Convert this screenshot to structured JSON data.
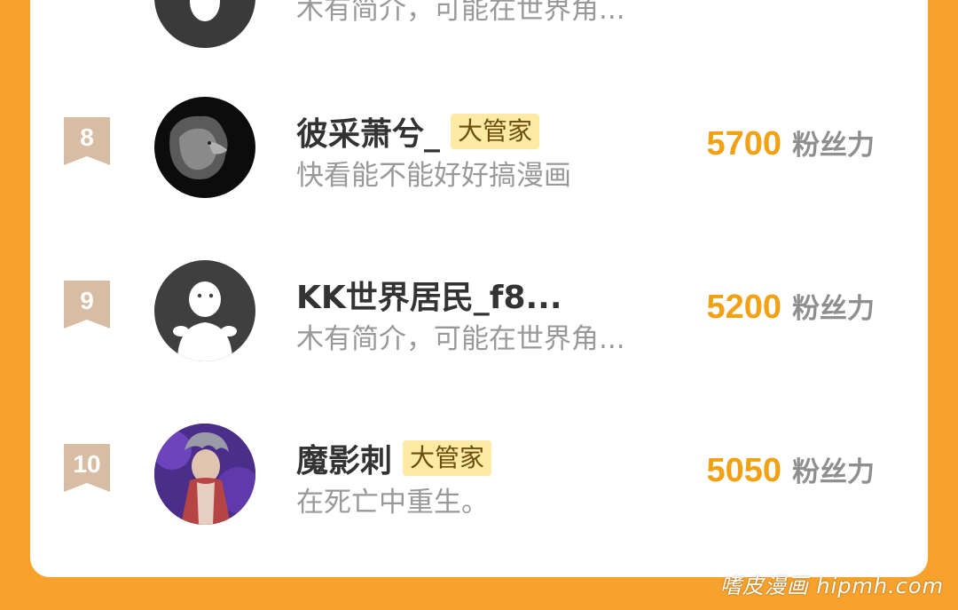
{
  "partial_row": {
    "bio": "木有简介，可能在世界角..."
  },
  "rows": [
    {
      "rank": "8",
      "name": "彼采萧兮_",
      "tag": "大管家",
      "bio": "快看能不能好好搞漫画",
      "score": "5700",
      "unit": "粉丝力",
      "avatar_icon": "lion-avatar"
    },
    {
      "rank": "9",
      "name": "KK世界居民_f8...",
      "tag": "",
      "bio": "木有简介，可能在世界角...",
      "score": "5200",
      "unit": "粉丝力",
      "avatar_icon": "default-person-avatar"
    },
    {
      "rank": "10",
      "name": "魔影刺",
      "tag": "大管家",
      "bio": "在死亡中重生。",
      "score": "5050",
      "unit": "粉丝力",
      "avatar_icon": "anime-character-avatar"
    }
  ],
  "watermark": "嗜皮漫画 hipmh.com",
  "colors": {
    "background": "#f7a22c",
    "score": "#f3a114",
    "tag_bg": "#fdeaa3",
    "rank_badge": "#d6bda4"
  }
}
